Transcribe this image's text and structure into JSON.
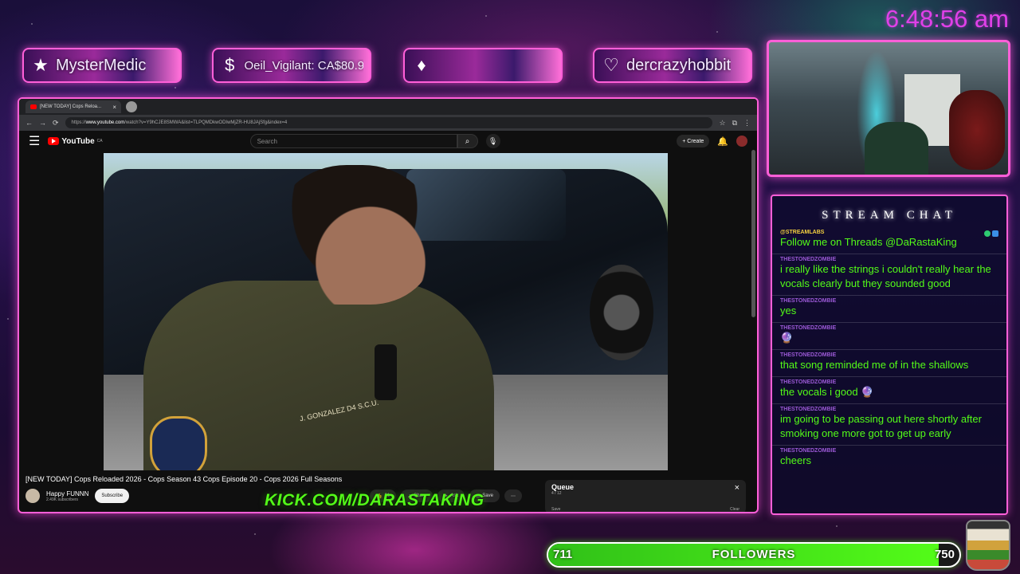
{
  "clock": "6:48:56 am",
  "alerts": [
    {
      "icon": "★",
      "icon_name": "star-icon",
      "text": "MysterMedic"
    },
    {
      "icon": "$",
      "icon_name": "dollar-icon",
      "text": "Oeil_Vigilant: CA$80.94"
    },
    {
      "icon": "♦",
      "icon_name": "diamond-icon",
      "text": ""
    },
    {
      "icon": "♡",
      "icon_name": "heart-icon",
      "text": "dercrazyhobbit"
    }
  ],
  "browser": {
    "tab_title": "[NEW TODAY] Cops Reloa...",
    "url_prefix": "https://",
    "url_host": "www.youtube.com",
    "url_rest": "/watch?v=Y9hCJE8SMWA&list=TLPQMDkwODIwMjZR-HU8JAjSfg&index=4",
    "youtube": {
      "logo": "YouTube",
      "logo_country": "CA",
      "search_placeholder": "Search",
      "create_label": "+ Create",
      "video_title": "[NEW TODAY] Cops Reloaded 2026 - Cops Season 43 Cops Episode 20 - Cops 2026 Full Seasons",
      "channel_name": "Happy FUNNN",
      "channel_subs": "2.49K subscribers",
      "subscribe_label": "Subscribe",
      "like_label": "21",
      "share_label": "Share",
      "ask_label": "Ask",
      "save_label": "Save",
      "more_label": "⋯",
      "nametag": "J. GONZALEZ D4 S.C.U.",
      "queue": {
        "title": "Queue",
        "count": "4 / 12",
        "save": "Save",
        "clear": "Clear"
      }
    }
  },
  "kick_url": "KICK.COM/DARASTAKING",
  "chat": {
    "title": "STREAM CHAT",
    "messages": [
      {
        "user": "@STREAMLABS",
        "text": "Follow me on Threads @DaRastaKing"
      },
      {
        "user": "THESTONEDZOMBIE",
        "text": "i really like the strings i couldn't really hear the vocals clearly but they sounded good"
      },
      {
        "user": "THESTONEDZOMBIE",
        "text": "yes"
      },
      {
        "user": "THESTONEDZOMBIE",
        "text": "🔮"
      },
      {
        "user": "THESTONEDZOMBIE",
        "text": "that song reminded me of in the shallows"
      },
      {
        "user": "THESTONEDZOMBIE",
        "text": "the vocals i good 🔮"
      },
      {
        "user": "THESTONEDZOMBIE",
        "text": "im going to be passing out here shortly after smoking one more got to get up early"
      },
      {
        "user": "THESTONEDZOMBIE",
        "text": "cheers"
      }
    ]
  },
  "followers": {
    "start": "711",
    "label": "FOLLOWERS",
    "end": "750",
    "progress_fraction": 0.95
  },
  "colors": {
    "accent_pink": "#ff5fd8",
    "kick_green": "#53fc18",
    "clock_magenta": "#e040e8"
  }
}
